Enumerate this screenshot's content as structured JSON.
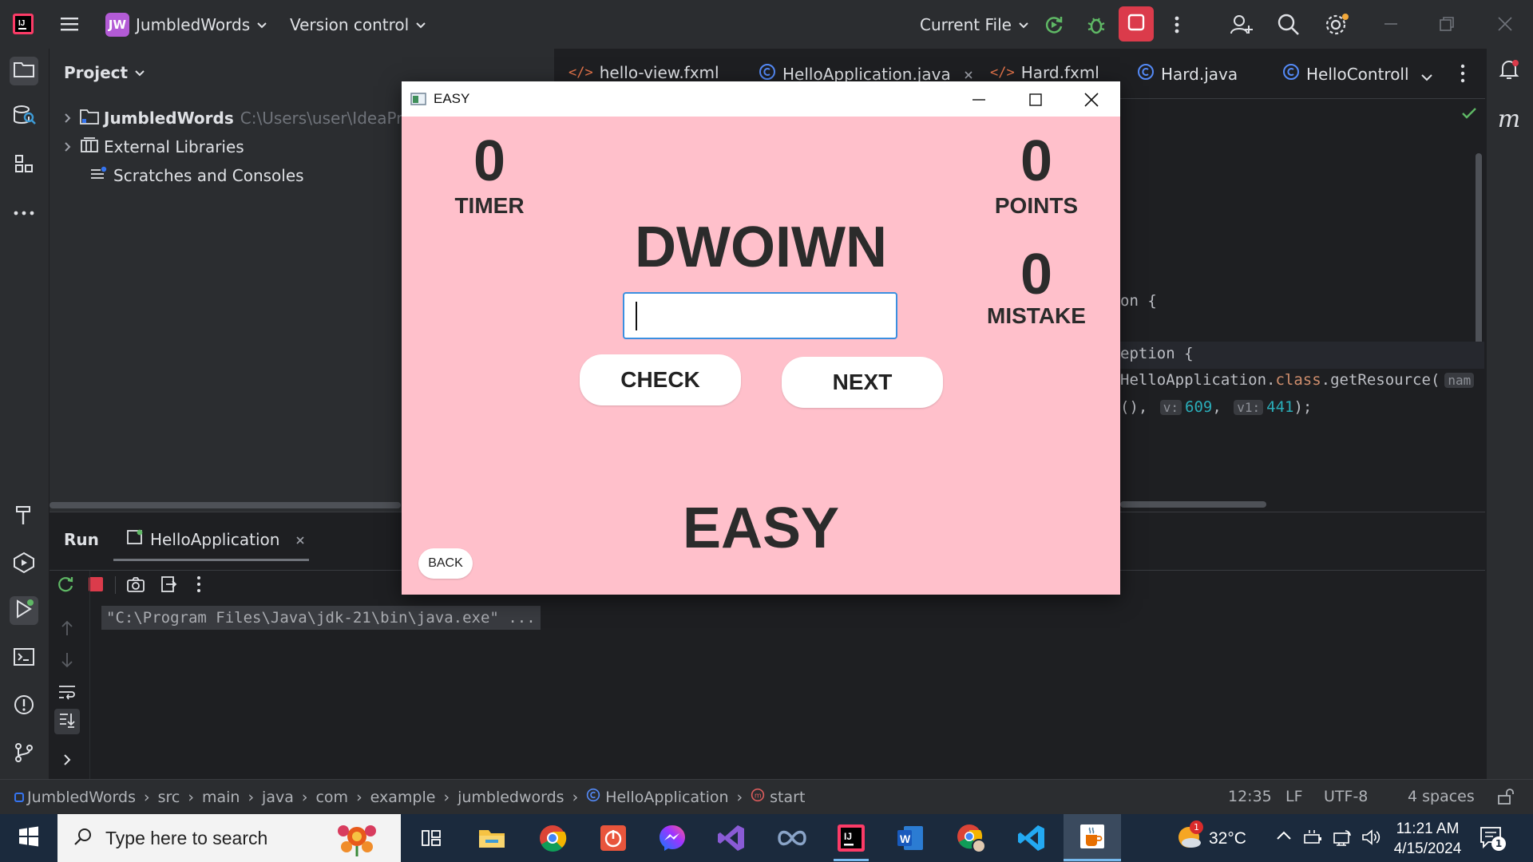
{
  "titlebar": {
    "project_badge": "JW",
    "project_name": "JumbledWords",
    "vcs": "Version control",
    "run_config": "Current File"
  },
  "project_panel": {
    "title": "Project",
    "tree": [
      {
        "label": "JumbledWords",
        "path": "C:\\Users\\user\\IdeaPro"
      },
      {
        "label": "External Libraries"
      },
      {
        "label": "Scratches and Consoles"
      }
    ]
  },
  "editor": {
    "tabs": [
      {
        "label": "hello-view.fxml"
      },
      {
        "label": "HelloApplication.java"
      },
      {
        "label": "Hard.fxml"
      },
      {
        "label": "Hard.java"
      },
      {
        "label": "HelloControll"
      }
    ],
    "code": {
      "line1": "on {",
      "line2": "eption {",
      "line3_a": "HelloApplication.",
      "line3_b": "class",
      "line3_c": ".getResource(",
      "line3_hint": "nam",
      "line4_a": "(), ",
      "line4_hint1": "v:",
      "line4_v1": "609",
      "line4_sep": ", ",
      "line4_hint2": "v1:",
      "line4_v2": "441",
      "line4_end": ");"
    }
  },
  "run_panel": {
    "title": "Run",
    "tab": "HelloApplication",
    "console_line": "\"C:\\Program Files\\Java\\jdk-21\\bin\\java.exe\" ..."
  },
  "statusbar": {
    "breadcrumb": [
      "JumbledWords",
      "src",
      "main",
      "java",
      "com",
      "example",
      "jumbledwords",
      "HelloApplication",
      "start"
    ],
    "position": "12:35",
    "line_sep": "LF",
    "encoding": "UTF-8",
    "indent": "4 spaces"
  },
  "taskbar": {
    "search_placeholder": "Type here to search",
    "weather": "32°C",
    "time": "11:21 AM",
    "date": "4/15/2024",
    "notif_count": "1",
    "weather_badge": "1"
  },
  "dialog": {
    "window_title": "EASY",
    "timer_value": "0",
    "timer_label": "TIMER",
    "points_value": "0",
    "points_label": "POINTS",
    "mistake_value": "0",
    "mistake_label": "MISTAKE",
    "jumbled_word": "DWOIWN",
    "answer_value": "",
    "check_label": "CHECK",
    "next_label": "NEXT",
    "level_label": "EASY",
    "back_label": "BACK"
  },
  "colors": {
    "dialog_bg": "#ffc0cb",
    "ide_bg": "#1e1f22",
    "panel_bg": "#2b2d30",
    "accent_blue": "#3574f0",
    "stop_red": "#db3b4b"
  }
}
